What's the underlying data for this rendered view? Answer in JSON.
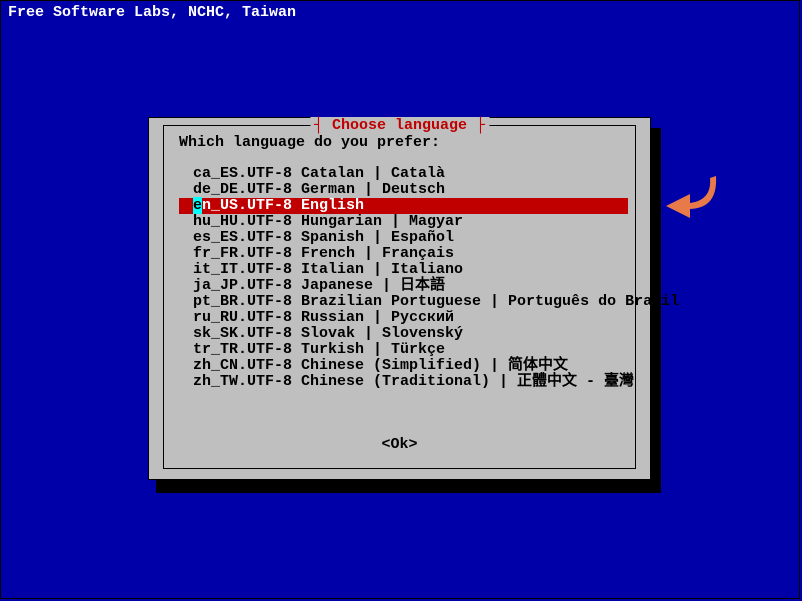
{
  "header": "Free Software Labs, NCHC, Taiwan",
  "dialog": {
    "title": "Choose language",
    "prompt": "Which language do you prefer:",
    "ok": "<Ok>",
    "selected_index": 2,
    "items": [
      "ca_ES.UTF-8 Catalan | Català",
      "de_DE.UTF-8 German | Deutsch",
      "en_US.UTF-8 English",
      "hu_HU.UTF-8 Hungarian | Magyar",
      "es_ES.UTF-8 Spanish | Español",
      "fr_FR.UTF-8 French | Français",
      "it_IT.UTF-8 Italian | Italiano",
      "ja_JP.UTF-8 Japanese | 日本語",
      "pt_BR.UTF-8 Brazilian Portuguese | Português do Brasil",
      "ru_RU.UTF-8 Russian | Русский",
      "sk_SK.UTF-8 Slovak | Slovenský",
      "tr_TR.UTF-8 Turkish | Türkçe",
      "zh_CN.UTF-8 Chinese (Simplified) | 简体中文",
      "zh_TW.UTF-8 Chinese (Traditional) | 正體中文 - 臺灣"
    ]
  }
}
